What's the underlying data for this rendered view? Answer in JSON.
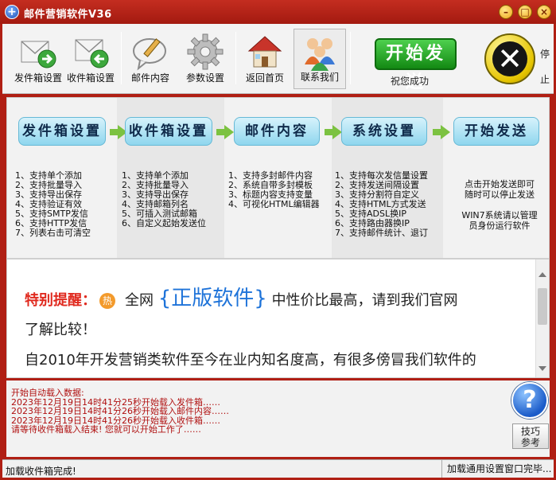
{
  "window": {
    "title": "邮件营销软件V36"
  },
  "toolbar": {
    "items": [
      {
        "label": "发件箱设置",
        "icon": "outbox-envelope-icon"
      },
      {
        "label": "收件箱设置",
        "icon": "inbox-envelope-icon"
      },
      {
        "label": "邮件内容",
        "icon": "speech-pencil-icon"
      },
      {
        "label": "参数设置",
        "icon": "gear-icon"
      },
      {
        "label": "返回首页",
        "icon": "home-icon"
      },
      {
        "label": "联系我们",
        "icon": "people-icon"
      }
    ],
    "start_label": "开始发送",
    "start_status": "祝您成功",
    "stop_label": "停止"
  },
  "flow": {
    "steps": [
      "发件箱设置",
      "收件箱设置",
      "邮件内容",
      "系统设置",
      "开始发送"
    ],
    "columns": [
      [
        "1、支持单个添加",
        "2、支持批量导入",
        "3、支持导出保存",
        "4、支持验证有效",
        "5、支持SMTP发信",
        "6、支持HTTP发信",
        "7、列表右击可清空"
      ],
      [
        "1、支持单个添加",
        "2、支持批量导入",
        "3、支持导出保存",
        "4、支持邮箱列名",
        "5、可插入测试邮箱",
        "6、自定义起始发送位"
      ],
      [
        "1、支持多封邮件内容",
        "2、系统自带多封模板",
        "3、标题内容支持变量",
        "4、可视化HTML编辑器"
      ],
      [
        "1、支持每次发信量设置",
        "2、支持发送间隔设置",
        "3、支持分割符自定义",
        "4、支持HTML方式发送",
        "5、支持ADSL换IP",
        "6、支持路由器换IP",
        "7、支持邮件统计、退订"
      ],
      [
        "点击开始发送即可",
        "随时可以停止发送",
        "",
        "WIN7系统请以管理",
        "员身份运行软件"
      ]
    ]
  },
  "notice": {
    "tip_label": "特别提醒：",
    "hot_badge": "热",
    "pre": "全网",
    "highlight": "{正版软件}",
    "post": "中性价比最高，请到我们官网",
    "line2": "了解比较！",
    "line3": "自2010年开发营销类软件至今在业内知名度高，有很多傍冒我们软件的"
  },
  "log": {
    "lines": [
      "开始自动载入数据:",
      "2023年12月19日14时41分25秒开始载入发件箱……",
      "2023年12月19日14时41分26秒开始载入邮件内容……",
      "2023年12月19日14时41分26秒开始载入收件箱……",
      "请等待收件箱载入结束! 您就可以开始工作了……"
    ]
  },
  "side": {
    "help": "?",
    "tips_line1": "技巧",
    "tips_line2": "参考"
  },
  "status": {
    "left": "加载收件箱完成!",
    "right": "加载通用设置窗口完毕..."
  },
  "colors": {
    "frame": "#b01f14",
    "log_text": "#b01010",
    "highlight": "#1e73d9",
    "tip": "#e02a1f",
    "start": "#1a9a1a"
  }
}
